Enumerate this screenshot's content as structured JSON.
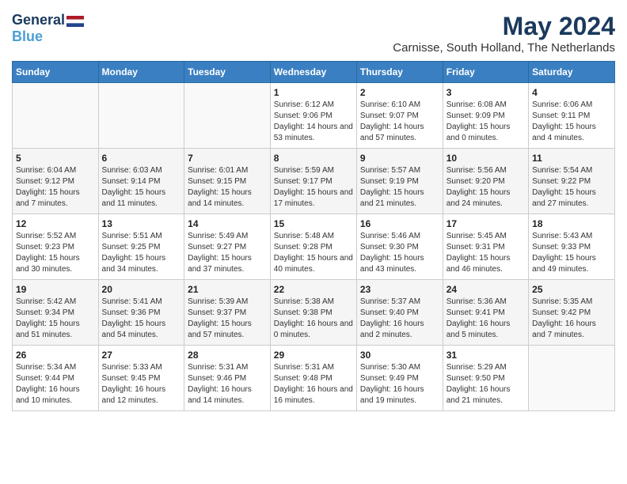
{
  "header": {
    "logo_general": "General",
    "logo_blue": "Blue",
    "title": "May 2024",
    "subtitle": "Carnisse, South Holland, The Netherlands"
  },
  "calendar": {
    "days_of_week": [
      "Sunday",
      "Monday",
      "Tuesday",
      "Wednesday",
      "Thursday",
      "Friday",
      "Saturday"
    ],
    "weeks": [
      [
        {
          "day": "",
          "info": ""
        },
        {
          "day": "",
          "info": ""
        },
        {
          "day": "",
          "info": ""
        },
        {
          "day": "1",
          "info": "Sunrise: 6:12 AM\nSunset: 9:06 PM\nDaylight: 14 hours\nand 53 minutes."
        },
        {
          "day": "2",
          "info": "Sunrise: 6:10 AM\nSunset: 9:07 PM\nDaylight: 14 hours\nand 57 minutes."
        },
        {
          "day": "3",
          "info": "Sunrise: 6:08 AM\nSunset: 9:09 PM\nDaylight: 15 hours\nand 0 minutes."
        },
        {
          "day": "4",
          "info": "Sunrise: 6:06 AM\nSunset: 9:11 PM\nDaylight: 15 hours\nand 4 minutes."
        }
      ],
      [
        {
          "day": "5",
          "info": "Sunrise: 6:04 AM\nSunset: 9:12 PM\nDaylight: 15 hours\nand 7 minutes."
        },
        {
          "day": "6",
          "info": "Sunrise: 6:03 AM\nSunset: 9:14 PM\nDaylight: 15 hours\nand 11 minutes."
        },
        {
          "day": "7",
          "info": "Sunrise: 6:01 AM\nSunset: 9:15 PM\nDaylight: 15 hours\nand 14 minutes."
        },
        {
          "day": "8",
          "info": "Sunrise: 5:59 AM\nSunset: 9:17 PM\nDaylight: 15 hours\nand 17 minutes."
        },
        {
          "day": "9",
          "info": "Sunrise: 5:57 AM\nSunset: 9:19 PM\nDaylight: 15 hours\nand 21 minutes."
        },
        {
          "day": "10",
          "info": "Sunrise: 5:56 AM\nSunset: 9:20 PM\nDaylight: 15 hours\nand 24 minutes."
        },
        {
          "day": "11",
          "info": "Sunrise: 5:54 AM\nSunset: 9:22 PM\nDaylight: 15 hours\nand 27 minutes."
        }
      ],
      [
        {
          "day": "12",
          "info": "Sunrise: 5:52 AM\nSunset: 9:23 PM\nDaylight: 15 hours\nand 30 minutes."
        },
        {
          "day": "13",
          "info": "Sunrise: 5:51 AM\nSunset: 9:25 PM\nDaylight: 15 hours\nand 34 minutes."
        },
        {
          "day": "14",
          "info": "Sunrise: 5:49 AM\nSunset: 9:27 PM\nDaylight: 15 hours\nand 37 minutes."
        },
        {
          "day": "15",
          "info": "Sunrise: 5:48 AM\nSunset: 9:28 PM\nDaylight: 15 hours\nand 40 minutes."
        },
        {
          "day": "16",
          "info": "Sunrise: 5:46 AM\nSunset: 9:30 PM\nDaylight: 15 hours\nand 43 minutes."
        },
        {
          "day": "17",
          "info": "Sunrise: 5:45 AM\nSunset: 9:31 PM\nDaylight: 15 hours\nand 46 minutes."
        },
        {
          "day": "18",
          "info": "Sunrise: 5:43 AM\nSunset: 9:33 PM\nDaylight: 15 hours\nand 49 minutes."
        }
      ],
      [
        {
          "day": "19",
          "info": "Sunrise: 5:42 AM\nSunset: 9:34 PM\nDaylight: 15 hours\nand 51 minutes."
        },
        {
          "day": "20",
          "info": "Sunrise: 5:41 AM\nSunset: 9:36 PM\nDaylight: 15 hours\nand 54 minutes."
        },
        {
          "day": "21",
          "info": "Sunrise: 5:39 AM\nSunset: 9:37 PM\nDaylight: 15 hours\nand 57 minutes."
        },
        {
          "day": "22",
          "info": "Sunrise: 5:38 AM\nSunset: 9:38 PM\nDaylight: 16 hours\nand 0 minutes."
        },
        {
          "day": "23",
          "info": "Sunrise: 5:37 AM\nSunset: 9:40 PM\nDaylight: 16 hours\nand 2 minutes."
        },
        {
          "day": "24",
          "info": "Sunrise: 5:36 AM\nSunset: 9:41 PM\nDaylight: 16 hours\nand 5 minutes."
        },
        {
          "day": "25",
          "info": "Sunrise: 5:35 AM\nSunset: 9:42 PM\nDaylight: 16 hours\nand 7 minutes."
        }
      ],
      [
        {
          "day": "26",
          "info": "Sunrise: 5:34 AM\nSunset: 9:44 PM\nDaylight: 16 hours\nand 10 minutes."
        },
        {
          "day": "27",
          "info": "Sunrise: 5:33 AM\nSunset: 9:45 PM\nDaylight: 16 hours\nand 12 minutes."
        },
        {
          "day": "28",
          "info": "Sunrise: 5:31 AM\nSunset: 9:46 PM\nDaylight: 16 hours\nand 14 minutes."
        },
        {
          "day": "29",
          "info": "Sunrise: 5:31 AM\nSunset: 9:48 PM\nDaylight: 16 hours\nand 16 minutes."
        },
        {
          "day": "30",
          "info": "Sunrise: 5:30 AM\nSunset: 9:49 PM\nDaylight: 16 hours\nand 19 minutes."
        },
        {
          "day": "31",
          "info": "Sunrise: 5:29 AM\nSunset: 9:50 PM\nDaylight: 16 hours\nand 21 minutes."
        },
        {
          "day": "",
          "info": ""
        }
      ]
    ]
  }
}
